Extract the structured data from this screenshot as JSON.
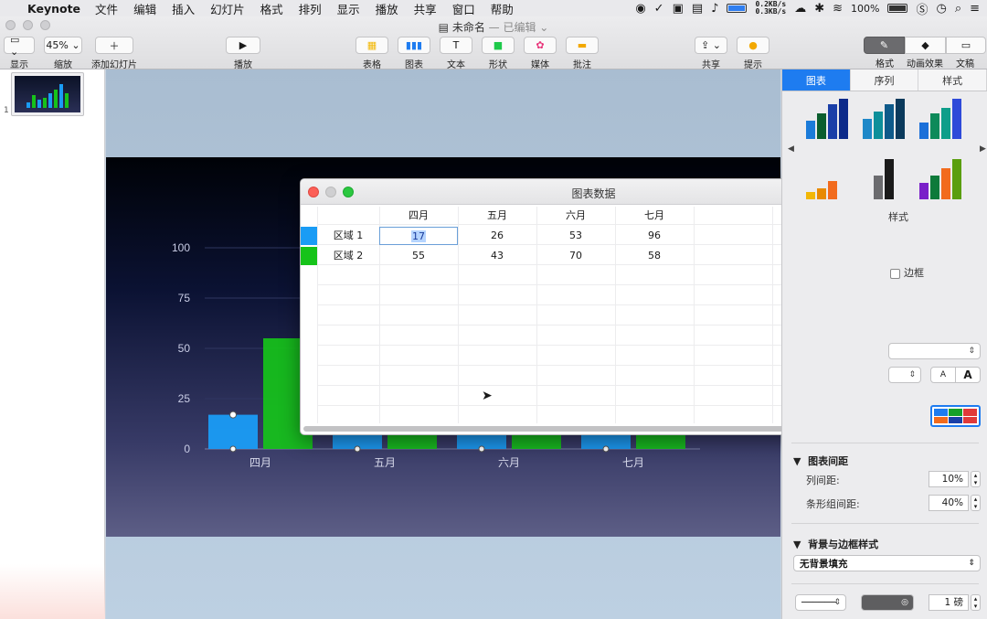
{
  "menubar": {
    "app_name": "Keynote",
    "items": [
      "文件",
      "编辑",
      "插入",
      "幻灯片",
      "格式",
      "排列",
      "显示",
      "播放",
      "共享",
      "窗口",
      "帮助"
    ],
    "net_up": "0.2KB/s",
    "net_down": "0.3KB/s",
    "battery_pct": "100%"
  },
  "window": {
    "doc_name": "未命名",
    "doc_state": "— 已编辑 ⌄"
  },
  "toolbar": {
    "view_label": "显示",
    "zoom_value": "45%",
    "zoom_label": "缩放",
    "add_slide_label": "添加幻灯片",
    "play_label": "播放",
    "table_label": "表格",
    "chart_label": "图表",
    "text_label": "文本",
    "shape_label": "形状",
    "media_label": "媒体",
    "comment_label": "批注",
    "share_label": "共享",
    "tips_label": "提示",
    "format_label": "格式",
    "animate_label": "动画效果",
    "document_label": "文稿"
  },
  "navigator": {
    "slide_number": "1"
  },
  "chart_data": {
    "type": "bar",
    "categories": [
      "四月",
      "五月",
      "六月",
      "七月"
    ],
    "series": [
      {
        "name": "区域 1",
        "values": [
          17,
          26,
          53,
          96
        ],
        "color": "#1a9cf5"
      },
      {
        "name": "区域 2",
        "values": [
          55,
          43,
          70,
          58
        ],
        "color": "#16c31a"
      }
    ],
    "ylim": [
      0,
      100
    ],
    "yticks": [
      0,
      25,
      50,
      75,
      100
    ],
    "grid": true
  },
  "data_editor": {
    "title": "图表数据",
    "view_rows_icon": "list-icon",
    "view_cols_icon": "columns-icon",
    "headers": [
      "四月",
      "五月",
      "六月",
      "七月"
    ],
    "rows": [
      {
        "label": "区域 1",
        "values": [
          "17",
          "26",
          "53",
          "96"
        ],
        "color": "#1a9cf5"
      },
      {
        "label": "区域 2",
        "values": [
          "55",
          "43",
          "70",
          "58"
        ],
        "color": "#16c31a"
      }
    ]
  },
  "inspector": {
    "tabs": [
      "图表",
      "序列",
      "样式"
    ],
    "chart_style_label": "样式",
    "border_label": "边框",
    "gap_section": "图表间距",
    "column_gap_label": "列间距:",
    "column_gap_value": "10%",
    "set_gap_label": "条形组间距:",
    "set_gap_value": "40%",
    "background_section": "背景与边框样式",
    "fill_value": "无背景填充",
    "stroke_width_value": "1 磅",
    "font_small": "A",
    "font_large": "A"
  }
}
